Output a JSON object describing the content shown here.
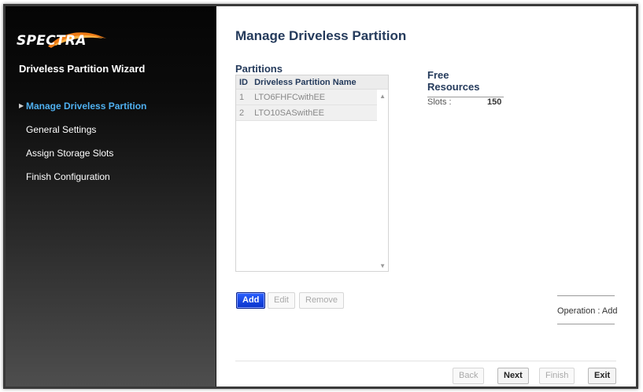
{
  "brand": {
    "logo_text": "SPECTRA",
    "colors": {
      "swoosh": "#f07c16",
      "swoosh_highlight": "#ffb347",
      "active_nav": "#4fb0f0",
      "primary_button": "#1446e6",
      "title": "#253b5c"
    }
  },
  "sidebar": {
    "title": "Driveless Partition Wizard",
    "items": [
      {
        "label": "Manage Driveless Partition",
        "active": true,
        "icon": "triangle-right-icon"
      },
      {
        "label": "General Settings",
        "active": false
      },
      {
        "label": "Assign Storage Slots",
        "active": false
      },
      {
        "label": "Finish Configuration",
        "active": false
      }
    ]
  },
  "main": {
    "title": "Manage Driveless Partition",
    "partitions": {
      "section_title": "Partitions",
      "columns": [
        "ID",
        "Driveless Partition Name"
      ],
      "rows": [
        {
          "id": "1",
          "name": "LTO6FHFCwithEE"
        },
        {
          "id": "2",
          "name": "LTO10SASwithEE"
        }
      ]
    },
    "free_resources": {
      "title": "Free Resources",
      "slots_label": "Slots :",
      "slots_value": "150"
    },
    "actions": {
      "add": "Add",
      "edit": "Edit",
      "remove": "Remove"
    },
    "operation": "Operation : Add",
    "footer": {
      "back": "Back",
      "next": "Next",
      "finish": "Finish",
      "exit": "Exit"
    }
  }
}
